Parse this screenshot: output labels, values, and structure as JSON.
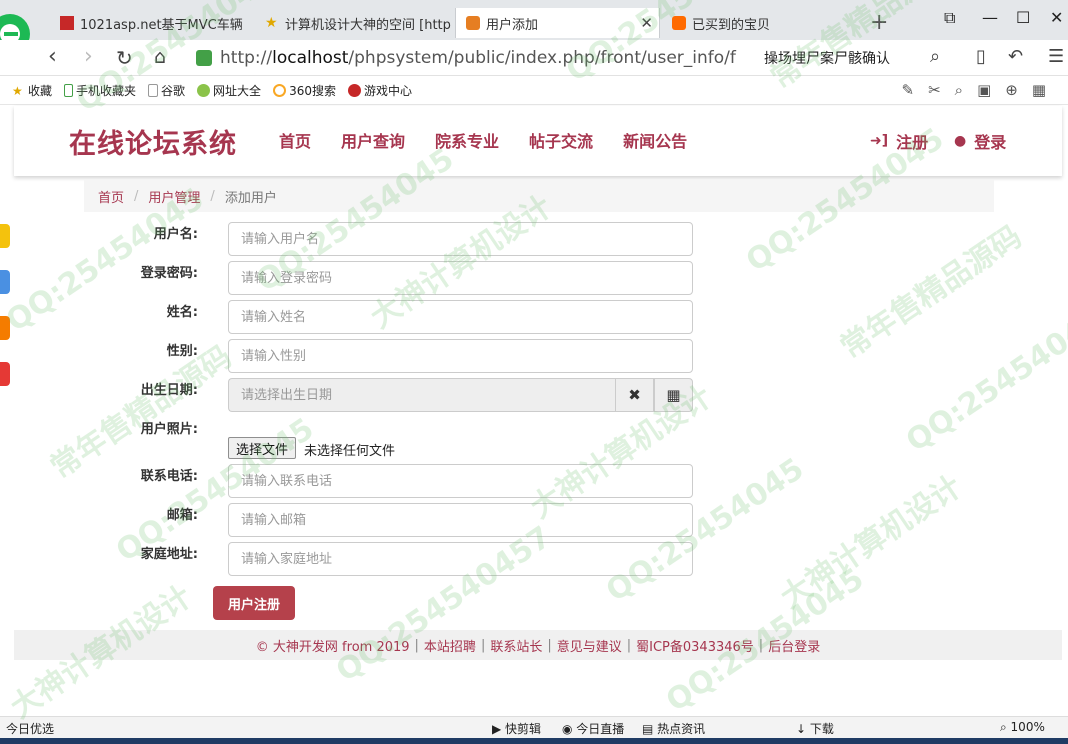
{
  "browser": {
    "tabs": [
      {
        "label": "1021asp.net基于MVC车辆",
        "active": false
      },
      {
        "label": "计算机设计大神的空间 [http",
        "active": false
      },
      {
        "label": "用户添加",
        "active": true
      },
      {
        "label": "已买到的宝贝",
        "active": false
      }
    ],
    "new_tab_glyph": "+",
    "window_controls": [
      "⧉",
      "—",
      "☐",
      "✕"
    ],
    "address_protocol": "http://",
    "address_host": "localhost",
    "address_path": "/phpsystem/public/index.php/front/user_info/f",
    "search_text": "操场埋尸案尸骸确认",
    "bookmarks": [
      "收藏",
      "手机收藏夹",
      "谷歌",
      "网址大全",
      "360搜索",
      "游戏中心"
    ],
    "status_left": "今日优选",
    "status_items": [
      "快剪辑",
      "今日直播",
      "热点资讯",
      "下载",
      "100%"
    ]
  },
  "site": {
    "brand": "在线论坛系统",
    "nav": [
      "首页",
      "用户查询",
      "院系专业",
      "帖子交流",
      "新闻公告"
    ],
    "register_label": "注册",
    "login_label": "登录"
  },
  "breadcrumb": {
    "home": "首页",
    "section": "用户管理",
    "current": "添加用户",
    "separator": "/"
  },
  "form": {
    "username": {
      "label": "用户名:",
      "placeholder": "请输入用户名"
    },
    "password": {
      "label": "登录密码:",
      "placeholder": "请输入登录密码"
    },
    "realname": {
      "label": "姓名:",
      "placeholder": "请输入姓名"
    },
    "gender": {
      "label": "性别:",
      "placeholder": "请输入性别"
    },
    "birthday": {
      "label": "出生日期:",
      "placeholder": "请选择出生日期"
    },
    "photo": {
      "label": "用户照片:",
      "button": "选择文件",
      "status": "未选择任何文件"
    },
    "phone": {
      "label": "联系电话:",
      "placeholder": "请输入联系电话"
    },
    "email": {
      "label": "邮箱:",
      "placeholder": "请输入邮箱"
    },
    "address": {
      "label": "家庭地址:",
      "placeholder": "请输入家庭地址"
    },
    "submit_label": "用户注册"
  },
  "footer": {
    "copyright": "© 大神开发网 from 2019",
    "links": [
      "本站招聘",
      "联系站长",
      "意见与建议",
      "蜀ICP备0343346号",
      "后台登录"
    ]
  },
  "watermark": {
    "qq": "QQ:25454045",
    "qq_full": "QQ:254540457",
    "design": "大神计算机设计",
    "seller": "常年售精品源码"
  },
  "colors": {
    "brand": "#a6364f",
    "submit": "#b5414b",
    "footer_bg": "#f0f0f0"
  }
}
